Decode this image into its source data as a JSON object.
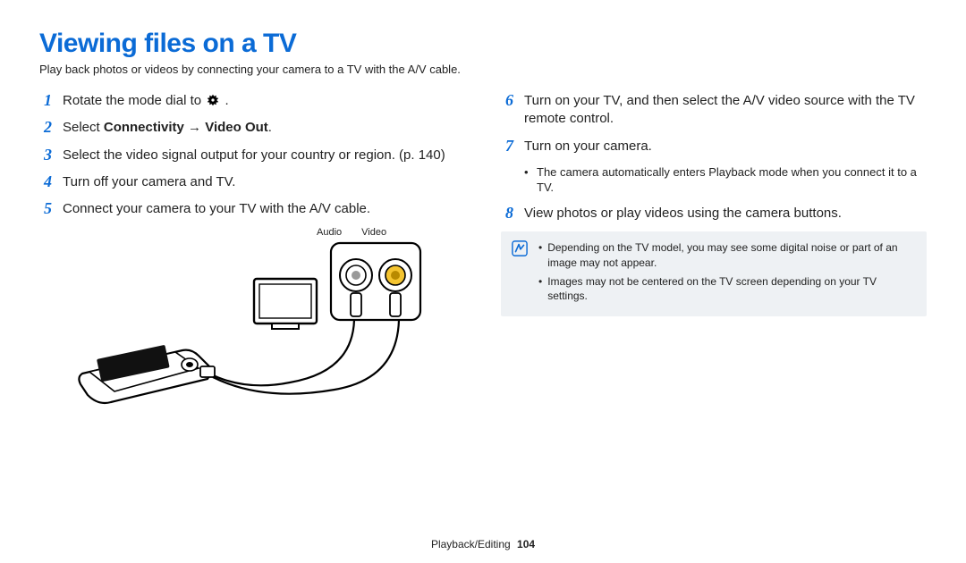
{
  "title": "Viewing files on a TV",
  "subtitle": "Play back photos or videos by connecting your camera to a TV with the A/V cable.",
  "left_steps": [
    {
      "num": "1",
      "pre": "Rotate the mode dial to ",
      "icon": "gear",
      "post": " ."
    },
    {
      "num": "2",
      "pre": "Select ",
      "bold": "Connectivity → Video Out",
      "post": "."
    },
    {
      "num": "3",
      "text": "Select the video signal output for your country or region. (p. 140)"
    },
    {
      "num": "4",
      "text": "Turn off your camera and TV."
    },
    {
      "num": "5",
      "text": "Connect your camera to your TV with the A/V cable."
    }
  ],
  "diagram_labels": {
    "audio": "Audio",
    "video": "Video"
  },
  "right_steps": [
    {
      "num": "6",
      "text": "Turn on your TV, and then select the A/V video source with the TV remote control."
    },
    {
      "num": "7",
      "text": "Turn on your camera.",
      "sub": "The camera automatically enters Playback mode when you connect it to a TV."
    },
    {
      "num": "8",
      "text": "View photos or play videos using the camera buttons."
    }
  ],
  "notes": [
    "Depending on the TV model, you may see some digital noise or part of an image may not appear.",
    "Images may not be centered on the TV screen depending on your TV settings."
  ],
  "footer_section": "Playback/Editing",
  "footer_page": "104"
}
